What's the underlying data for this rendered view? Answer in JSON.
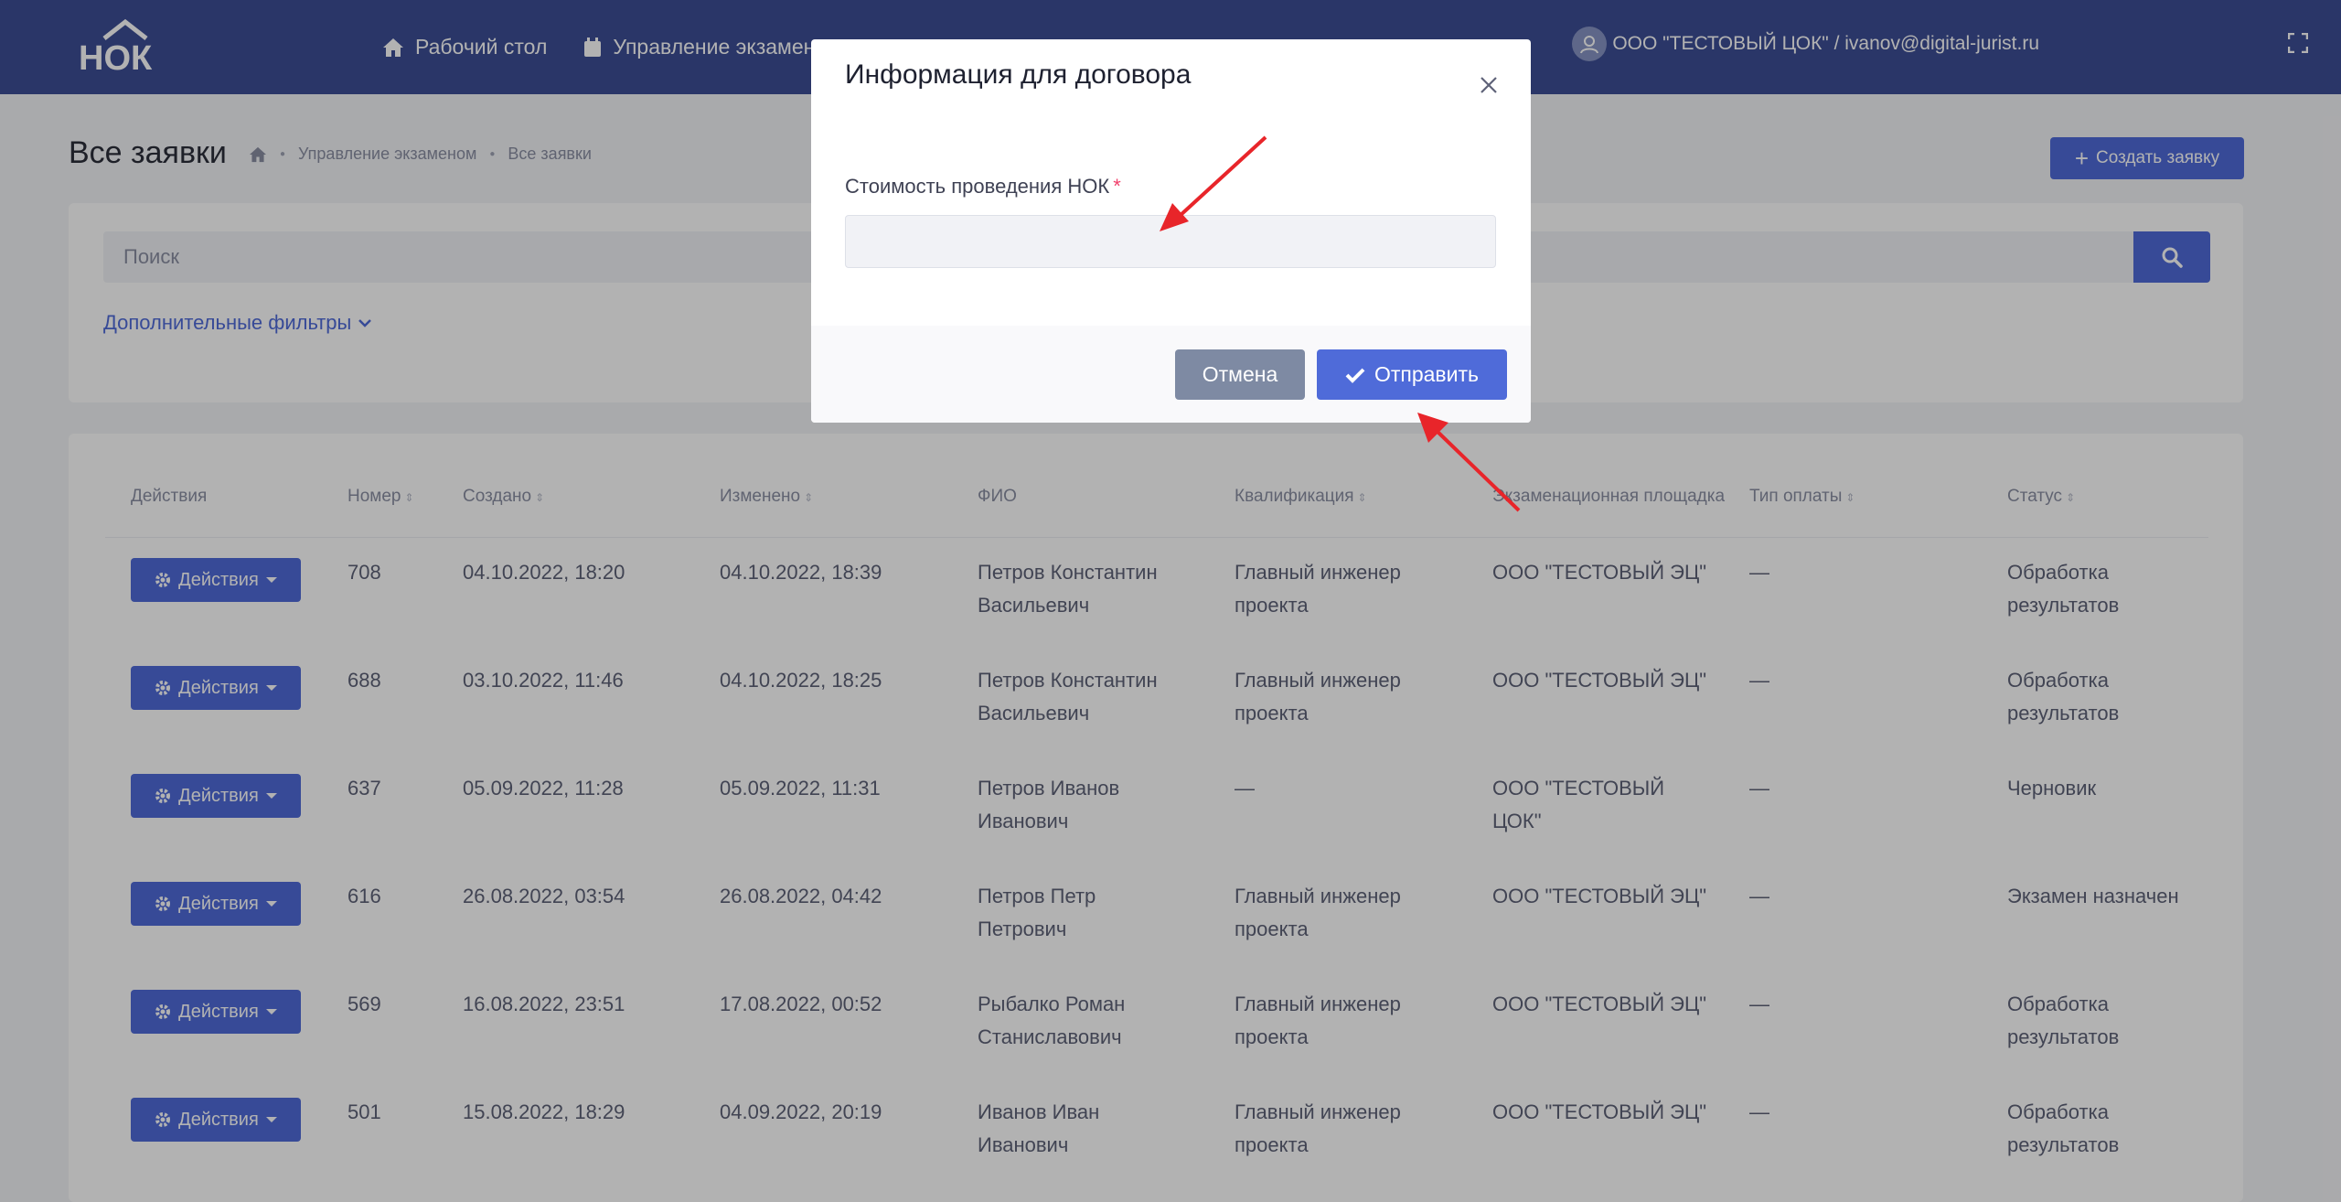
{
  "nav": {
    "items": [
      {
        "label": "Рабочий стол",
        "icon": "home-icon"
      },
      {
        "label": "Управление экзаменом",
        "icon": "calendar-icon"
      }
    ],
    "user": "ООО \"ТЕСТОВЫЙ ЦОК\" / ivanov@digital-jurist.ru"
  },
  "page": {
    "title": "Все заявки",
    "breadcrumb": [
      "Управление экзаменом",
      "Все заявки"
    ],
    "create_button": "Создать заявку"
  },
  "search": {
    "placeholder": "Поиск",
    "filters_link": "Дополнительные фильтры"
  },
  "table": {
    "columns": [
      "Действия",
      "Номер",
      "Создано",
      "Изменено",
      "ФИО",
      "Квалификация",
      "Экзаменационная площадка",
      "Тип оплаты",
      "Статус"
    ],
    "actions_label": "Действия",
    "rows": [
      {
        "number": "708",
        "created": "04.10.2022, 18:20",
        "changed": "04.10.2022, 18:39",
        "fio": [
          "Петров Константин",
          "Васильевич"
        ],
        "qual": [
          "Главный инженер",
          "проекта"
        ],
        "site": [
          "ООО \"ТЕСТОВЫЙ ЭЦ\""
        ],
        "pay": "—",
        "status": [
          "Обработка",
          "результатов"
        ]
      },
      {
        "number": "688",
        "created": "03.10.2022, 11:46",
        "changed": "04.10.2022, 18:25",
        "fio": [
          "Петров Константин",
          "Васильевич"
        ],
        "qual": [
          "Главный инженер",
          "проекта"
        ],
        "site": [
          "ООО \"ТЕСТОВЫЙ ЭЦ\""
        ],
        "pay": "—",
        "status": [
          "Обработка",
          "результатов"
        ]
      },
      {
        "number": "637",
        "created": "05.09.2022, 11:28",
        "changed": "05.09.2022, 11:31",
        "fio": [
          "Петров Иванов",
          "Иванович"
        ],
        "qual": [
          "—"
        ],
        "site": [
          "ООО \"ТЕСТОВЫЙ",
          "ЦОК\""
        ],
        "pay": "—",
        "status": [
          "Черновик"
        ]
      },
      {
        "number": "616",
        "created": "26.08.2022, 03:54",
        "changed": "26.08.2022, 04:42",
        "fio": [
          "Петров Петр",
          "Петрович"
        ],
        "qual": [
          "Главный инженер",
          "проекта"
        ],
        "site": [
          "ООО \"ТЕСТОВЫЙ ЭЦ\""
        ],
        "pay": "—",
        "status": [
          "Экзамен назначен"
        ]
      },
      {
        "number": "569",
        "created": "16.08.2022, 23:51",
        "changed": "17.08.2022, 00:52",
        "fio": [
          "Рыбалко Роман",
          "Станиславович"
        ],
        "qual": [
          "Главный инженер",
          "проекта"
        ],
        "site": [
          "ООО \"ТЕСТОВЫЙ ЭЦ\""
        ],
        "pay": "—",
        "status": [
          "Обработка",
          "результатов"
        ]
      },
      {
        "number": "501",
        "created": "15.08.2022, 18:29",
        "changed": "04.09.2022, 20:19",
        "fio": [
          "Иванов Иван",
          "Иванович"
        ],
        "qual": [
          "Главный инженер",
          "проекта"
        ],
        "site": [
          "ООО \"ТЕСТОВЫЙ ЭЦ\""
        ],
        "pay": "—",
        "status": [
          "Обработка",
          "результатов"
        ]
      }
    ]
  },
  "modal": {
    "title": "Информация для договора",
    "field_label": "Стоимость проведения НОК",
    "required_mark": "*",
    "field_value": "",
    "cancel": "Отмена",
    "submit": "Отправить"
  },
  "colors": {
    "primary": "#4f6bd9",
    "navbar": "#3d4e95",
    "cancel": "#7e8aa3",
    "annotation_arrow": "#e8252a",
    "required": "#f1416c"
  }
}
